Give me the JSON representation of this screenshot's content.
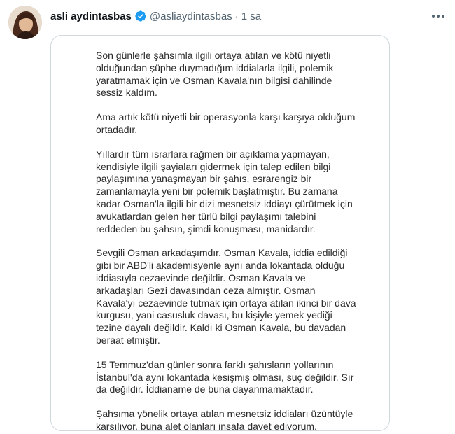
{
  "tweet": {
    "author": {
      "display_name": "asli aydintasbas",
      "handle": "@asliaydintasbas",
      "verified": true,
      "verified_color": "#1d9bf0"
    },
    "separator": "·",
    "timestamp": "1 sa",
    "more_icon": "ellipsis-icon",
    "statement_paragraphs": [
      "Son günlerle şahsımla ilgili ortaya atılan ve kötü niyetli olduğundan şüphe duymadığım iddialarla ilgili, polemik yaratmamak için ve Osman Kavala'nın bilgisi dahilinde sessiz kaldım.",
      "Ama artık kötü niyetli bir operasyonla karşı karşıya olduğum ortadadır.",
      "Yıllardır tüm ısrarlara rağmen bir açıklama yapmayan, kendisiyle ilgili şayiaları gidermek için talep edilen bilgi paylaşımına yanaşmayan bir şahıs, esrarengiz bir zamanlamayla yeni bir polemik başlatmıştır. Bu zamana kadar Osman'la ilgili bir dizi mesnetsiz iddiayı çürütmek için avukatlardan gelen her türlü bilgi paylaşımı talebini reddeden bu şahsın, şimdi konuşması, manidardır.",
      "Sevgili Osman arkadaşımdır. Osman Kavala, iddia edildiği gibi bir ABD'li akademisyenle aynı anda lokantada olduğu iddiasıyla cezaevinde değildir. Osman Kavala ve arkadaşları Gezi davasından ceza almıştır. Osman Kavala'yı cezaevinde tutmak için ortaya atılan ikinci bir dava kurgusu, yani casusluk davası, bu kişiyle yemek yediği tezine dayalı değildir. Kaldı ki Osman Kavala, bu davadan beraat etmiştir.",
      "15 Temmuz'dan günler sonra farklı şahısların yollarının İstanbul'da aynı lokantada kesişmiş olması, suç değildir. Sır da değildir. İddianame de buna dayanmamaktadır.",
      "Şahsıma yönelik ortaya atılan mesnetsiz iddiaları üzüntüyle karşılıyor, buna alet olanları insafa davet ediyorum."
    ]
  }
}
